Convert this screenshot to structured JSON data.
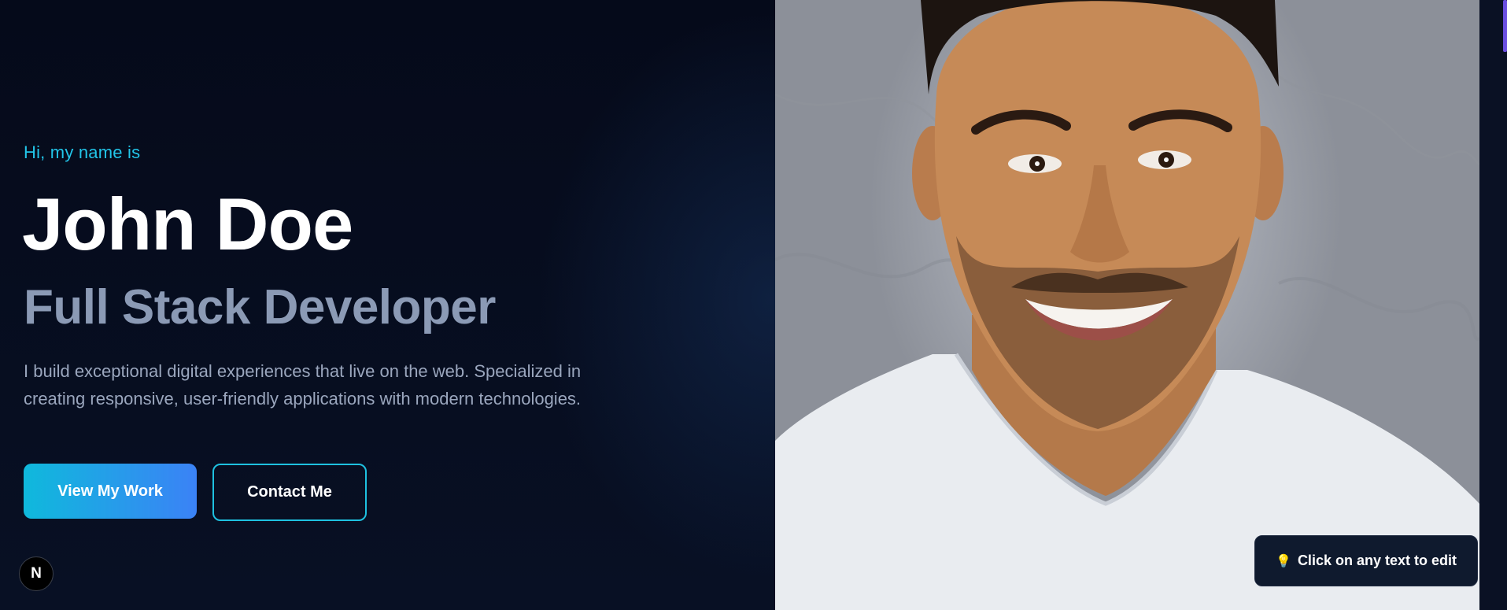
{
  "hero": {
    "greeting": "Hi, my name is",
    "name": "John Doe",
    "role": "Full Stack Developer",
    "bio": "I build exceptional digital experiences that live on the web. Specialized in creating responsive, user-friendly applications with modern technologies."
  },
  "actions": {
    "primary_label": "View My Work",
    "secondary_label": "Contact Me"
  },
  "toast": {
    "icon": "lightbulb-icon",
    "text": "Click on any text to edit"
  },
  "dev_badge": {
    "icon": "nextjs-icon",
    "letter": "N"
  },
  "colors": {
    "accent_cyan": "#22c5e8",
    "gradient_start": "#0fb9dc",
    "gradient_end": "#3b82f6",
    "background": "#060b1c",
    "muted_text": "#8b9ab5"
  }
}
